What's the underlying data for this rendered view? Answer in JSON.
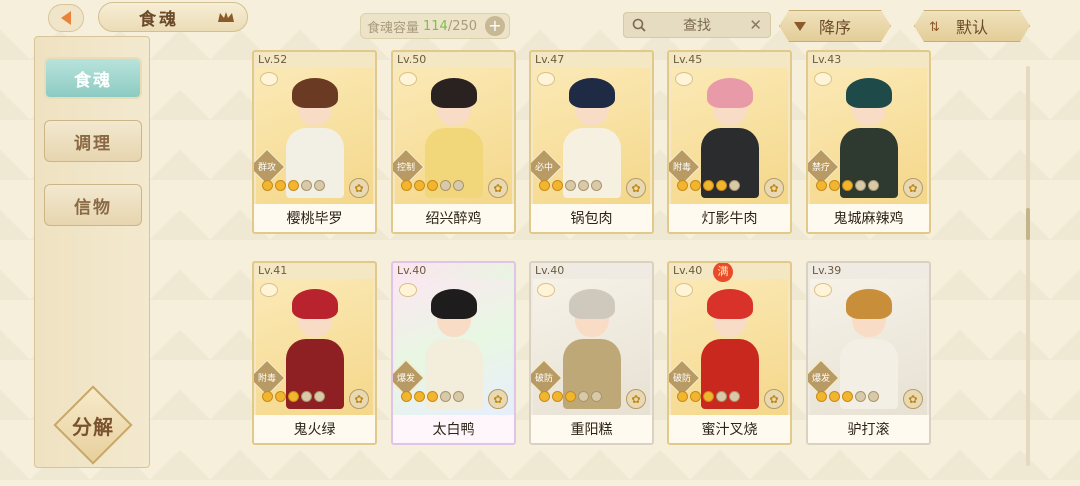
{
  "header": {
    "title": "食魂",
    "capacity_label": "食魂容量",
    "capacity_current": "114",
    "capacity_total": "/250",
    "plus_label": "+",
    "search_placeholder": "查找",
    "clear_label": "✕",
    "sort_label": "降序",
    "default_label": "默认"
  },
  "sidebar": {
    "tabs": [
      {
        "label": "食魂",
        "active": true
      },
      {
        "label": "调理",
        "active": false
      },
      {
        "label": "信物",
        "active": false
      }
    ],
    "decompose_label": "分解"
  },
  "cards": [
    {
      "level": "Lv.52",
      "name": "樱桃毕罗",
      "role": "群攻",
      "stars": 3,
      "hair": "#6b3a22",
      "body": "#f2efe4",
      "frame": "gold"
    },
    {
      "level": "Lv.50",
      "name": "绍兴醉鸡",
      "role": "控制",
      "stars": 3,
      "hair": "#2a2220",
      "body": "#f2d67a",
      "frame": "gold"
    },
    {
      "level": "Lv.47",
      "name": "锅包肉",
      "role": "必中",
      "stars": 2,
      "hair": "#1f2a44",
      "body": "#f6f0e0",
      "frame": "gold"
    },
    {
      "level": "Lv.45",
      "name": "灯影牛肉",
      "role": "附毒",
      "stars": 4,
      "hair": "#e99aa8",
      "body": "#2a2c2e",
      "frame": "gold"
    },
    {
      "level": "Lv.43",
      "name": "鬼城麻辣鸡",
      "role": "禁疗",
      "stars": 3,
      "hair": "#1e4a4a",
      "body": "#2e3a30",
      "frame": "gold"
    },
    {
      "level": "Lv.41",
      "name": "鬼火绿",
      "role": "附毒",
      "stars": 3,
      "hair": "#b8232e",
      "body": "#8e1f22",
      "frame": "gold"
    },
    {
      "level": "Lv.40",
      "name": "太白鸭",
      "role": "爆发",
      "stars": 3,
      "hair": "#1e1c1c",
      "body": "#f3eddc",
      "frame": "rainbow"
    },
    {
      "level": "Lv.40",
      "name": "重阳糕",
      "role": "破防",
      "stars": 3,
      "hair": "#cfc8bd",
      "body": "#bfa878",
      "frame": "white"
    },
    {
      "level": "Lv.40",
      "name": "蜜汁叉烧",
      "role": "破防",
      "stars": 3,
      "hair": "#d8322a",
      "body": "#c8281e",
      "frame": "gold",
      "badge": "满"
    },
    {
      "level": "Lv.39",
      "name": "驴打滚",
      "role": "爆发",
      "stars": 3,
      "hair": "#c98e3a",
      "body": "#f4efe4",
      "frame": "white"
    }
  ],
  "colors": {
    "accent_teal": "#8ccbc2",
    "gold_frame": "#e2c98a",
    "capacity_green": "#7fbf4a"
  }
}
